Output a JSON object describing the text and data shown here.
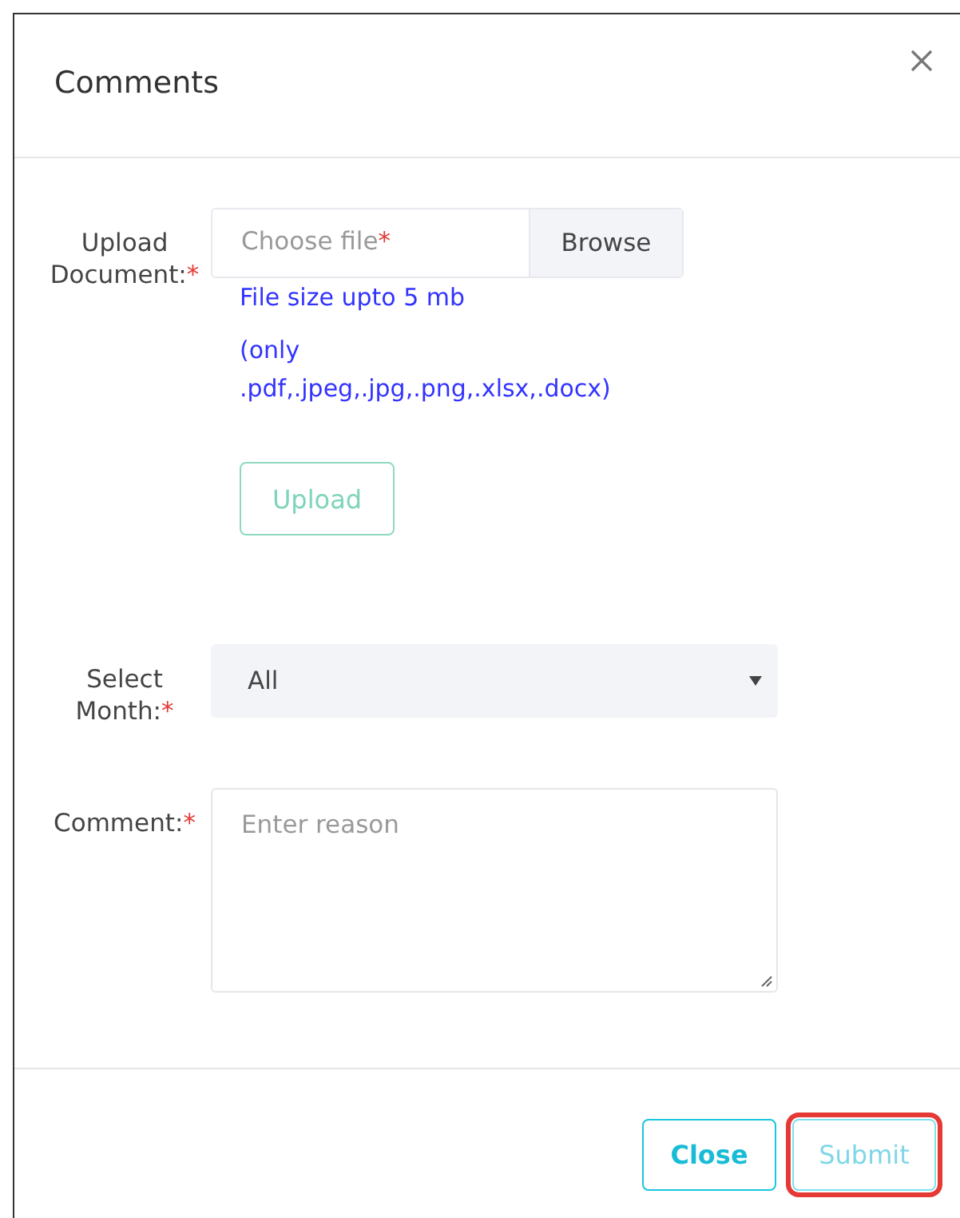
{
  "dialog": {
    "title": "Comments"
  },
  "fields": [
    {
      "kind": "file",
      "label": "Upload Document:",
      "mark": "*",
      "placeholder": "Choose file",
      "placeholder_mark": "*",
      "browse": "Browse",
      "hints": [
        "File size upto 5 mb",
        "(only .pdf,.jpeg,.jpg,.png,.xlsx,.docx)"
      ],
      "action": {
        "label": "Upload",
        "disabled": true
      }
    },
    {
      "kind": "select",
      "label": "Select Month:",
      "mark": "*",
      "value": "All"
    },
    {
      "kind": "textarea",
      "label": "Comment:",
      "mark": "*",
      "placeholder": "Enter reason"
    }
  ],
  "buttons": [
    {
      "label": "Close",
      "disabled": false,
      "highlighted": false
    },
    {
      "label": "Submit",
      "disabled": true,
      "highlighted": true
    }
  ]
}
